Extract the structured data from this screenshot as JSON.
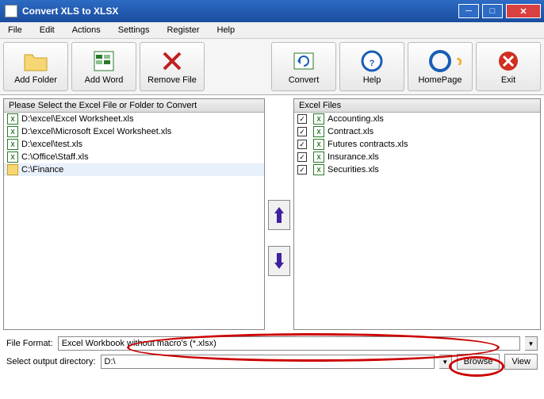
{
  "title": "Convert XLS to XLSX",
  "menu": [
    "File",
    "Edit",
    "Actions",
    "Settings",
    "Register",
    "Help"
  ],
  "toolbar": [
    {
      "label": "Add Folder",
      "icon": "folder"
    },
    {
      "label": "Add Word",
      "icon": "excel"
    },
    {
      "label": "Remove File",
      "icon": "remove"
    },
    {
      "label": "Convert",
      "icon": "convert"
    },
    {
      "label": "Help",
      "icon": "help"
    },
    {
      "label": "HomePage",
      "icon": "ie"
    },
    {
      "label": "Exit",
      "icon": "exit"
    }
  ],
  "left_panel": {
    "header": "Please Select the Excel File or Folder to Convert",
    "items": [
      {
        "type": "xls",
        "path": "D:\\excel\\Excel Worksheet.xls"
      },
      {
        "type": "xls",
        "path": "D:\\excel\\Microsoft Excel Worksheet.xls"
      },
      {
        "type": "xls",
        "path": "D:\\excel\\test.xls"
      },
      {
        "type": "xls",
        "path": "C:\\Office\\Staff.xls"
      },
      {
        "type": "folder",
        "path": "C:\\Finance",
        "selected": true
      }
    ]
  },
  "right_panel": {
    "header": "Excel Files",
    "items": [
      {
        "checked": true,
        "name": "Accounting.xls"
      },
      {
        "checked": true,
        "name": "Contract.xls"
      },
      {
        "checked": true,
        "name": "Futures contracts.xls"
      },
      {
        "checked": true,
        "name": "Insurance.xls"
      },
      {
        "checked": true,
        "name": "Securities.xls"
      }
    ]
  },
  "file_format": {
    "label": "File Format:",
    "value": "Excel Workbook without macro's (*.xlsx)"
  },
  "output_dir": {
    "label": "Select  output directory:",
    "value": "D:\\"
  },
  "buttons": {
    "browse": "Browse",
    "view": "View"
  }
}
